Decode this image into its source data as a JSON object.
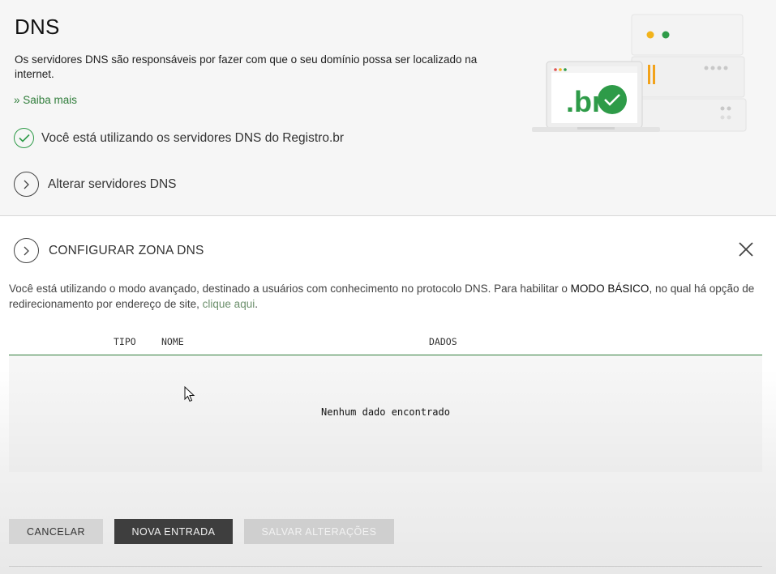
{
  "header": {
    "title": "DNS",
    "description": "Os servidores DNS são responsáveis por fazer com que o seu domínio possa ser localizado na internet.",
    "learn_more": "» Saiba mais",
    "status_text": "Você está utilizando os servidores DNS do Registro.br",
    "change_servers": "Alterar servidores DNS"
  },
  "illustration": {
    "logo_text": ".br",
    "colors": {
      "green": "#2e9b48",
      "yellow": "#f2b31b",
      "orange": "#f2a21b"
    }
  },
  "panel": {
    "title": "CONFIGURAR ZONA DNS",
    "mode_text_1": "Você está utilizando o modo avançado, destinado a usuários com conhecimento no protocolo DNS. Para habilitar o ",
    "mode_bold": "MODO BÁSICO",
    "mode_text_2": ", no qual há opção de redirecionamento por endereço de site, ",
    "mode_link": "clique aqui",
    "mode_text_3": ".",
    "table": {
      "columns": [
        "TIPO",
        "NOME",
        "DADOS"
      ],
      "empty_message": "Nenhum dado encontrado"
    },
    "buttons": {
      "cancel": "CANCELAR",
      "new_entry": "NOVA ENTRADA",
      "save": "SALVAR ALTERAÇÕES"
    }
  },
  "colors": {
    "accent_green": "#2f7d3a",
    "button_dark": "#3e3e3e",
    "button_disabled": "#cfcfcf"
  }
}
